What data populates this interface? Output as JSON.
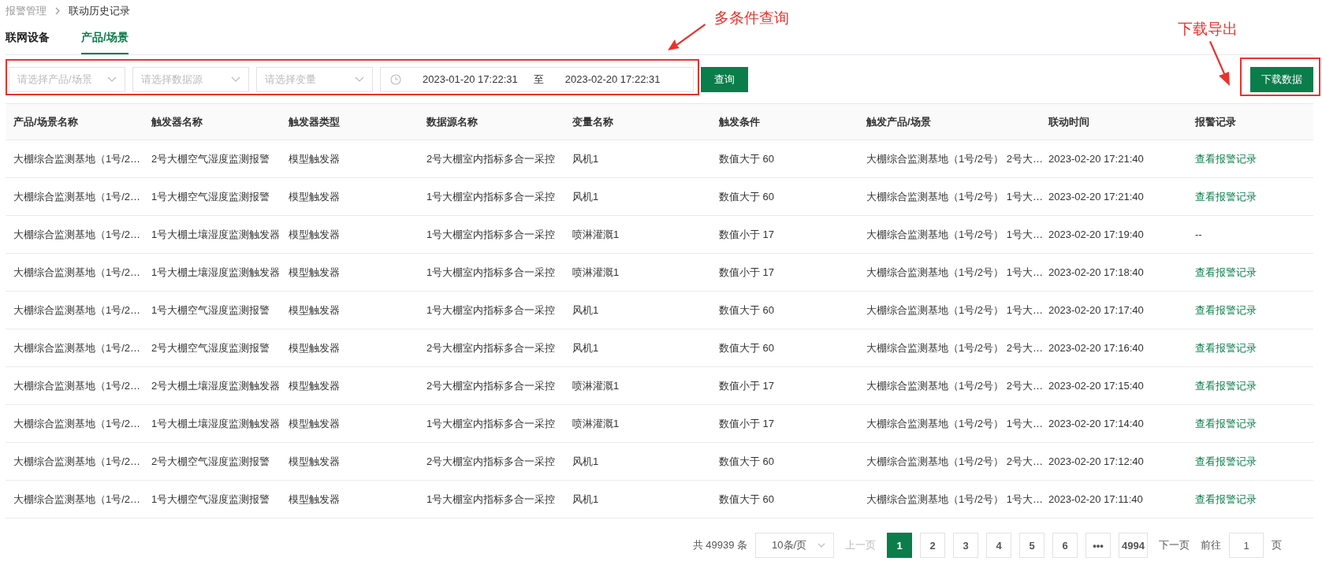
{
  "breadcrumb": [
    {
      "label": "报警管理",
      "current": false
    },
    {
      "label": "联动历史记录",
      "current": true
    }
  ],
  "tabs": [
    {
      "label": "联网设备",
      "selected": false
    },
    {
      "label": "产品/场景",
      "selected": true
    }
  ],
  "filters": {
    "selects": [
      {
        "placeholder": "请选择产品/场景"
      },
      {
        "placeholder": "请选择数据源"
      },
      {
        "placeholder": "请选择变量"
      }
    ],
    "date_range": {
      "start": "2023-01-20 17:22:31",
      "separator": "至",
      "end": "2023-02-20 17:22:31"
    },
    "query_button": "查询"
  },
  "download_button": "下载数据",
  "table": {
    "columns": [
      "产品/场景名称",
      "触发器名称",
      "触发器类型",
      "数据源名称",
      "变量名称",
      "触发条件",
      "触发产品/场景",
      "联动时间",
      "报警记录"
    ],
    "rows": [
      {
        "cells": [
          "大棚综合监测基地（1号/2…",
          "2号大棚空气湿度监测报警",
          "模型触发器",
          "2号大棚室内指标多合一采控",
          "风机1",
          "数值大于 60",
          "大棚综合监测基地（1号/2号） 2号大…",
          "2023-02-20 17:21:40"
        ],
        "record": {
          "kind": "link",
          "text": "查看报警记录"
        }
      },
      {
        "cells": [
          "大棚综合监测基地（1号/2…",
          "1号大棚空气湿度监测报警",
          "模型触发器",
          "1号大棚室内指标多合一采控",
          "风机1",
          "数值大于 60",
          "大棚综合监测基地（1号/2号） 1号大…",
          "2023-02-20 17:21:40"
        ],
        "record": {
          "kind": "link",
          "text": "查看报警记录"
        }
      },
      {
        "cells": [
          "大棚综合监测基地（1号/2…",
          "1号大棚土壤湿度监测触发器",
          "模型触发器",
          "1号大棚室内指标多合一采控",
          "喷淋灌溉1",
          "数值小于 17",
          "大棚综合监测基地（1号/2号） 1号大…",
          "2023-02-20 17:19:40"
        ],
        "record": {
          "kind": "text",
          "text": "--"
        }
      },
      {
        "cells": [
          "大棚综合监测基地（1号/2…",
          "1号大棚土壤湿度监测触发器",
          "模型触发器",
          "1号大棚室内指标多合一采控",
          "喷淋灌溉1",
          "数值小于 17",
          "大棚综合监测基地（1号/2号） 1号大…",
          "2023-02-20 17:18:40"
        ],
        "record": {
          "kind": "link",
          "text": "查看报警记录"
        }
      },
      {
        "cells": [
          "大棚综合监测基地（1号/2…",
          "1号大棚空气湿度监测报警",
          "模型触发器",
          "1号大棚室内指标多合一采控",
          "风机1",
          "数值大于 60",
          "大棚综合监测基地（1号/2号） 1号大…",
          "2023-02-20 17:17:40"
        ],
        "record": {
          "kind": "link",
          "text": "查看报警记录"
        }
      },
      {
        "cells": [
          "大棚综合监测基地（1号/2…",
          "2号大棚空气湿度监测报警",
          "模型触发器",
          "2号大棚室内指标多合一采控",
          "风机1",
          "数值大于 60",
          "大棚综合监测基地（1号/2号） 2号大…",
          "2023-02-20 17:16:40"
        ],
        "record": {
          "kind": "link",
          "text": "查看报警记录"
        }
      },
      {
        "cells": [
          "大棚综合监测基地（1号/2…",
          "2号大棚土壤湿度监测触发器",
          "模型触发器",
          "2号大棚室内指标多合一采控",
          "喷淋灌溉1",
          "数值小于 17",
          "大棚综合监测基地（1号/2号） 2号大…",
          "2023-02-20 17:15:40"
        ],
        "record": {
          "kind": "link",
          "text": "查看报警记录"
        }
      },
      {
        "cells": [
          "大棚综合监测基地（1号/2…",
          "1号大棚土壤湿度监测触发器",
          "模型触发器",
          "1号大棚室内指标多合一采控",
          "喷淋灌溉1",
          "数值小于 17",
          "大棚综合监测基地（1号/2号） 1号大…",
          "2023-02-20 17:14:40"
        ],
        "record": {
          "kind": "link",
          "text": "查看报警记录"
        }
      },
      {
        "cells": [
          "大棚综合监测基地（1号/2…",
          "2号大棚空气湿度监测报警",
          "模型触发器",
          "2号大棚室内指标多合一采控",
          "风机1",
          "数值大于 60",
          "大棚综合监测基地（1号/2号） 2号大…",
          "2023-02-20 17:12:40"
        ],
        "record": {
          "kind": "link",
          "text": "查看报警记录"
        }
      },
      {
        "cells": [
          "大棚综合监测基地（1号/2…",
          "1号大棚空气湿度监测报警",
          "模型触发器",
          "1号大棚室内指标多合一采控",
          "风机1",
          "数值大于 60",
          "大棚综合监测基地（1号/2号） 1号大…",
          "2023-02-20 17:11:40"
        ],
        "record": {
          "kind": "link",
          "text": "查看报警记录"
        }
      }
    ]
  },
  "pagination": {
    "total": "共 49939 条",
    "page_size": "10条/页",
    "prev": {
      "label": "上一页",
      "disabled": true
    },
    "pages": [
      {
        "label": "1",
        "selected": true
      },
      {
        "label": "2",
        "selected": false
      },
      {
        "label": "3",
        "selected": false
      },
      {
        "label": "4",
        "selected": false
      },
      {
        "label": "5",
        "selected": false
      },
      {
        "label": "6",
        "selected": false
      },
      {
        "label": "•••",
        "selected": false
      },
      {
        "label": "4994",
        "selected": false
      }
    ],
    "next": {
      "label": "下一页",
      "disabled": false
    },
    "goto_label": "前往",
    "goto_value": "1",
    "goto_unit": "页"
  },
  "annotations": [
    {
      "text": "多条件查询"
    },
    {
      "text": "下载导出"
    }
  ]
}
